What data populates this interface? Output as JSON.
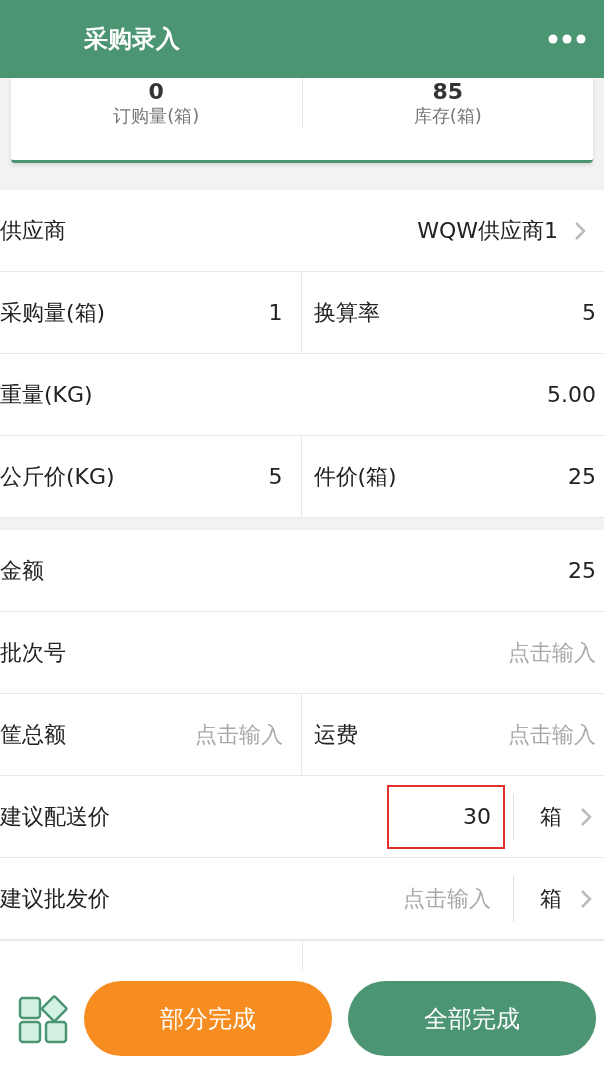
{
  "header": {
    "title": "采购录入"
  },
  "stats": [
    {
      "value": "0",
      "label": "订购量(箱)"
    },
    {
      "value": "85",
      "label": "库存(箱)"
    }
  ],
  "sections": [
    {
      "rows": [
        {
          "kind": "link",
          "label": "供应商",
          "value": "WQW供应商1"
        },
        {
          "kind": "pair",
          "cells": [
            {
              "label": "采购量(箱)",
              "value": "1"
            },
            {
              "label": "换算率",
              "value": "5"
            }
          ]
        },
        {
          "kind": "single",
          "label": "重量(KG)",
          "value": "5.00"
        },
        {
          "kind": "pair",
          "cells": [
            {
              "label": "公斤价(KG)",
              "value": "5"
            },
            {
              "label": "件价(箱)",
              "value": "25"
            }
          ]
        }
      ]
    },
    {
      "rows": [
        {
          "kind": "single",
          "label": "金额",
          "value": "25"
        },
        {
          "kind": "single",
          "label": "批次号",
          "placeholder": "点击输入"
        },
        {
          "kind": "pair",
          "cells": [
            {
              "label": "筐总额",
              "placeholder": "点击输入"
            },
            {
              "label": "运费",
              "placeholder": "点击输入"
            }
          ]
        },
        {
          "kind": "unit",
          "label": "建议配送价",
          "value": "30",
          "highlighted": true,
          "unit": "箱"
        },
        {
          "kind": "unit",
          "label": "建议批发价",
          "placeholder": "点击输入",
          "highlighted": false,
          "unit": "箱"
        }
      ]
    }
  ],
  "buttons": [
    {
      "label": "部分完成",
      "kind": "partial"
    },
    {
      "label": "全部完成",
      "kind": "full"
    }
  ]
}
